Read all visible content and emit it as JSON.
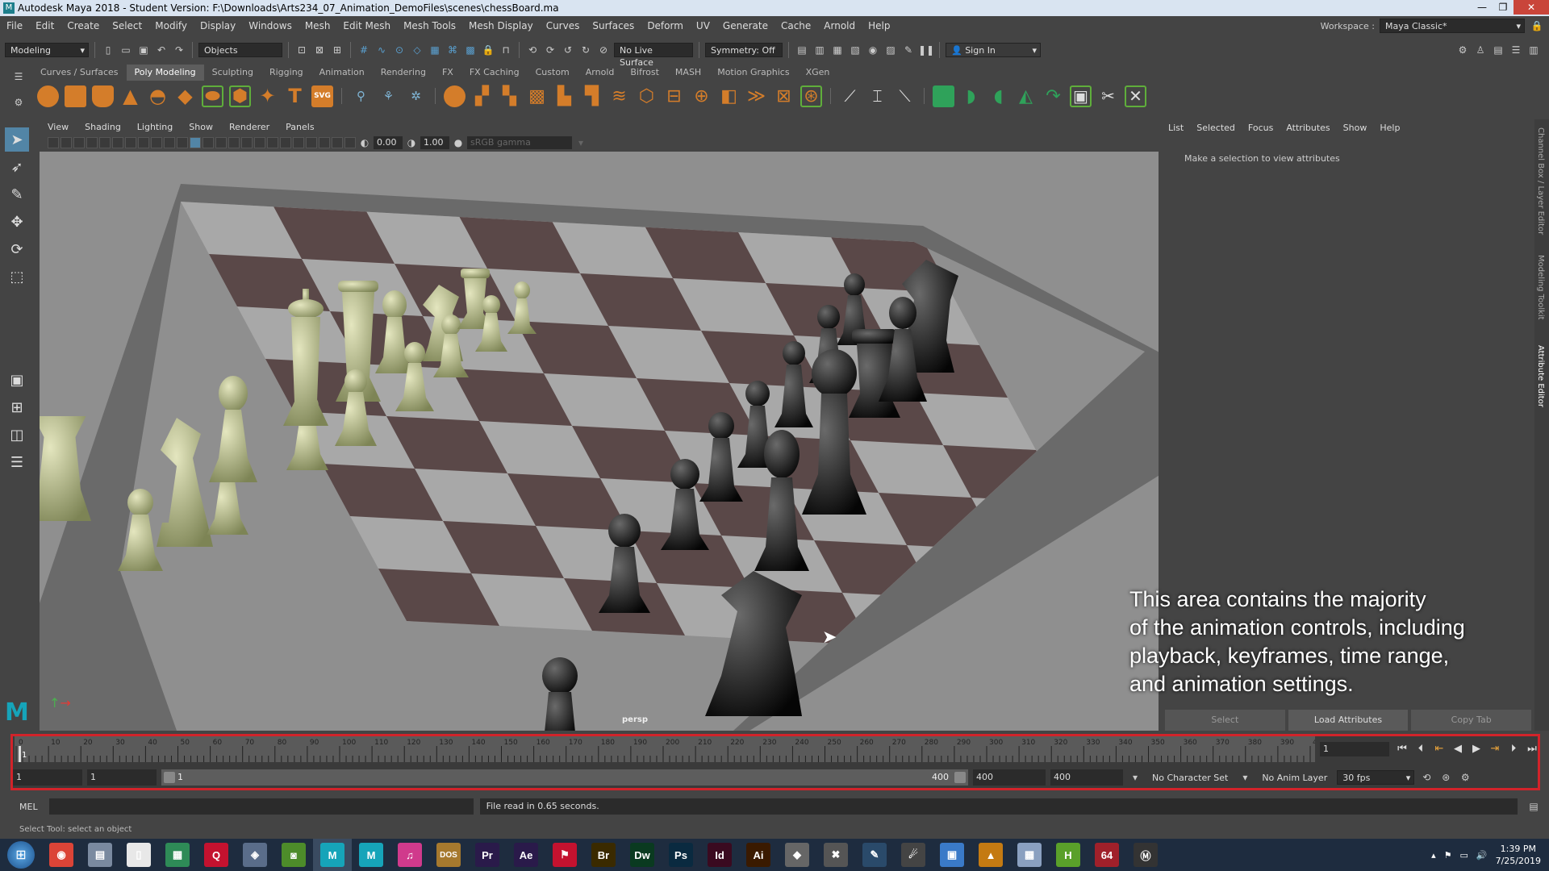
{
  "window": {
    "title": "Autodesk Maya 2018 - Student Version: F:\\Downloads\\Arts234_07_Animation_DemoFiles\\scenes\\chessBoard.ma",
    "minimize": "—",
    "maximize": "❐",
    "close": "✕"
  },
  "menubar": {
    "items": [
      "File",
      "Edit",
      "Create",
      "Select",
      "Modify",
      "Display",
      "Windows",
      "Mesh",
      "Edit Mesh",
      "Mesh Tools",
      "Mesh Display",
      "Curves",
      "Surfaces",
      "Deform",
      "UV",
      "Generate",
      "Cache",
      "Arnold",
      "Help"
    ],
    "workspace_label": "Workspace :",
    "workspace_value": "Maya Classic*"
  },
  "statusline": {
    "menuset": "Modeling",
    "selection_mode": "Objects",
    "live_surface": "No Live Surface",
    "symmetry": "Symmetry: Off",
    "sign_in": "Sign In"
  },
  "shelf": {
    "tabs": [
      "Curves / Surfaces",
      "Poly Modeling",
      "Sculpting",
      "Rigging",
      "Animation",
      "Rendering",
      "FX",
      "FX Caching",
      "Custom",
      "Arnold",
      "Bifrost",
      "MASH",
      "Motion Graphics",
      "XGen"
    ],
    "active_tab": "Poly Modeling",
    "svg_label": "SVG",
    "text_label": "T"
  },
  "panel": {
    "menus": [
      "View",
      "Shading",
      "Lighting",
      "Show",
      "Renderer",
      "Panels"
    ],
    "exposure": "0.00",
    "gamma": "1.00",
    "color_space": "sRGB gamma",
    "camera_label": "persp"
  },
  "attribute_editor": {
    "menus": [
      "List",
      "Selected",
      "Focus",
      "Attributes",
      "Show",
      "Help"
    ],
    "message": "Make a selection to view attributes",
    "buttons": [
      "Select",
      "Load Attributes",
      "Copy Tab"
    ],
    "side_tabs": [
      "Channel Box / Layer Editor",
      "Modeling Toolkit",
      "Attribute Editor"
    ]
  },
  "annotation": {
    "lines": [
      "This area contains the majority",
      "of the animation controls, including",
      "playback, keyframes, time range,",
      "and animation settings."
    ],
    "box_color": "#d2232a"
  },
  "time_slider": {
    "ticks": [
      "0",
      "10",
      "20",
      "30",
      "40",
      "50",
      "60",
      "70",
      "80",
      "90",
      "100",
      "110",
      "120",
      "130",
      "140",
      "150",
      "160",
      "170",
      "180",
      "190",
      "200",
      "210",
      "220",
      "230",
      "240",
      "250",
      "260",
      "270",
      "280",
      "290",
      "300",
      "310",
      "320",
      "330",
      "340",
      "350",
      "360",
      "370",
      "380",
      "390",
      "40"
    ],
    "current_marker": "1",
    "current_frame": "1"
  },
  "range_slider": {
    "start": "1",
    "playback_start": "1",
    "range_start": "1",
    "range_end": "400",
    "playback_end": "400",
    "end": "400",
    "character_set": "No Character Set",
    "anim_layer": "No Anim Layer",
    "fps": "30 fps"
  },
  "command_line": {
    "label": "MEL",
    "result": "File read in  0.65 seconds."
  },
  "help_line": "Select Tool: select an object",
  "taskbar": {
    "apps": [
      {
        "name": "chrome",
        "label": "◉",
        "color": "#db4437"
      },
      {
        "name": "files",
        "label": "▤",
        "color": "#7a8aa0"
      },
      {
        "name": "document",
        "label": "▯",
        "color": "#e8e8e8"
      },
      {
        "name": "spreadsheet",
        "label": "▦",
        "color": "#2e8b57"
      },
      {
        "name": "quicktime",
        "label": "Q",
        "color": "#c4122f"
      },
      {
        "name": "shield",
        "label": "◈",
        "color": "#5a6d8a"
      },
      {
        "name": "nvidia",
        "label": "◙",
        "color": "#4d8c2a"
      },
      {
        "name": "maya",
        "label": "M",
        "color": "#16a4b9"
      },
      {
        "name": "maya-2",
        "label": "M",
        "color": "#16a4b9"
      },
      {
        "name": "itunes",
        "label": "♫",
        "color": "#d03a8c"
      },
      {
        "name": "dos",
        "label": "DOS",
        "color": "#a6792e"
      },
      {
        "name": "premiere",
        "label": "Pr",
        "color": "#2a1a4a"
      },
      {
        "name": "after-effects",
        "label": "Ae",
        "color": "#2a1a4a"
      },
      {
        "name": "acrobat",
        "label": "⚑",
        "color": "#c4122f"
      },
      {
        "name": "bridge",
        "label": "Br",
        "color": "#3a2a00"
      },
      {
        "name": "dreamweaver",
        "label": "Dw",
        "color": "#0a3a20"
      },
      {
        "name": "photoshop",
        "label": "Ps",
        "color": "#0a2a40"
      },
      {
        "name": "indesign",
        "label": "Id",
        "color": "#3a0a20"
      },
      {
        "name": "illustrator",
        "label": "Ai",
        "color": "#3a1a00"
      },
      {
        "name": "badge",
        "label": "◆",
        "color": "#666666"
      },
      {
        "name": "tools",
        "label": "✖",
        "color": "#555555"
      },
      {
        "name": "writer",
        "label": "✎",
        "color": "#2a4a6a"
      },
      {
        "name": "satellite",
        "label": "☄",
        "color": "#444444"
      },
      {
        "name": "folders",
        "label": "▣",
        "color": "#3a7ac8"
      },
      {
        "name": "warning",
        "label": "▲",
        "color": "#c47a12"
      },
      {
        "name": "calculator",
        "label": "▦",
        "color": "#8aa0c0"
      },
      {
        "name": "houdini",
        "label": "H",
        "color": "#5aa02a"
      },
      {
        "name": "unity",
        "label": "64",
        "color": "#a0202a"
      },
      {
        "name": "medal",
        "label": "Ⓜ",
        "color": "#333333"
      }
    ],
    "time": "1:39 PM",
    "date": "7/25/2019"
  }
}
